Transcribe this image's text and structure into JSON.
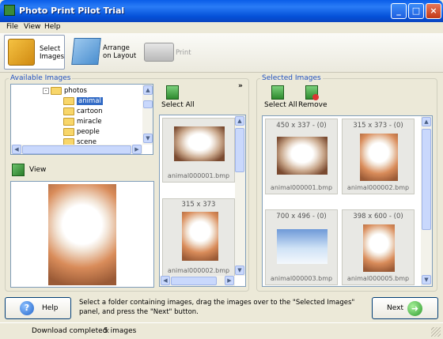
{
  "window": {
    "title": "Photo Print Pilot Trial"
  },
  "menu": [
    "File",
    "View",
    "Help"
  ],
  "toolbar": {
    "select": "Select\nImages",
    "arrange": "Arrange\non Layout",
    "print": "Print"
  },
  "available": {
    "legend": "Available Images",
    "tree": [
      {
        "label": "photos",
        "level": 0,
        "expanded": true
      },
      {
        "label": "animal",
        "level": 1,
        "selected": true
      },
      {
        "label": "cartoon",
        "level": 1
      },
      {
        "label": "miracle",
        "level": 1
      },
      {
        "label": "people",
        "level": 1
      },
      {
        "label": "scene",
        "level": 1
      }
    ],
    "view_label": "View",
    "select_all": "Select All",
    "more": "»",
    "thumbs": [
      {
        "dims": "",
        "name": "animal000001.bmp"
      },
      {
        "dims": "315 x 373",
        "name": "animal000002.bmp"
      }
    ]
  },
  "selected": {
    "legend": "Selected Images",
    "select_all": "Select All",
    "remove": "Remove",
    "thumbs": [
      {
        "dims": "450 x 337 - (0)",
        "name": "animal000001.bmp"
      },
      {
        "dims": "315 x 373 - (0)",
        "name": "animal000002.bmp"
      },
      {
        "dims": "700 x 496 - (0)",
        "name": "animal000003.bmp"
      },
      {
        "dims": "398 x 600 - (0)",
        "name": "animal000005.bmp"
      }
    ]
  },
  "footer": {
    "help": "Help",
    "instructions": "Select a folder containing images, drag the images over to the \"Selected Images\" panel, and press the \"Next\" button.",
    "next": "Next"
  },
  "status": {
    "label": "Download completed:",
    "count": "5 images"
  }
}
